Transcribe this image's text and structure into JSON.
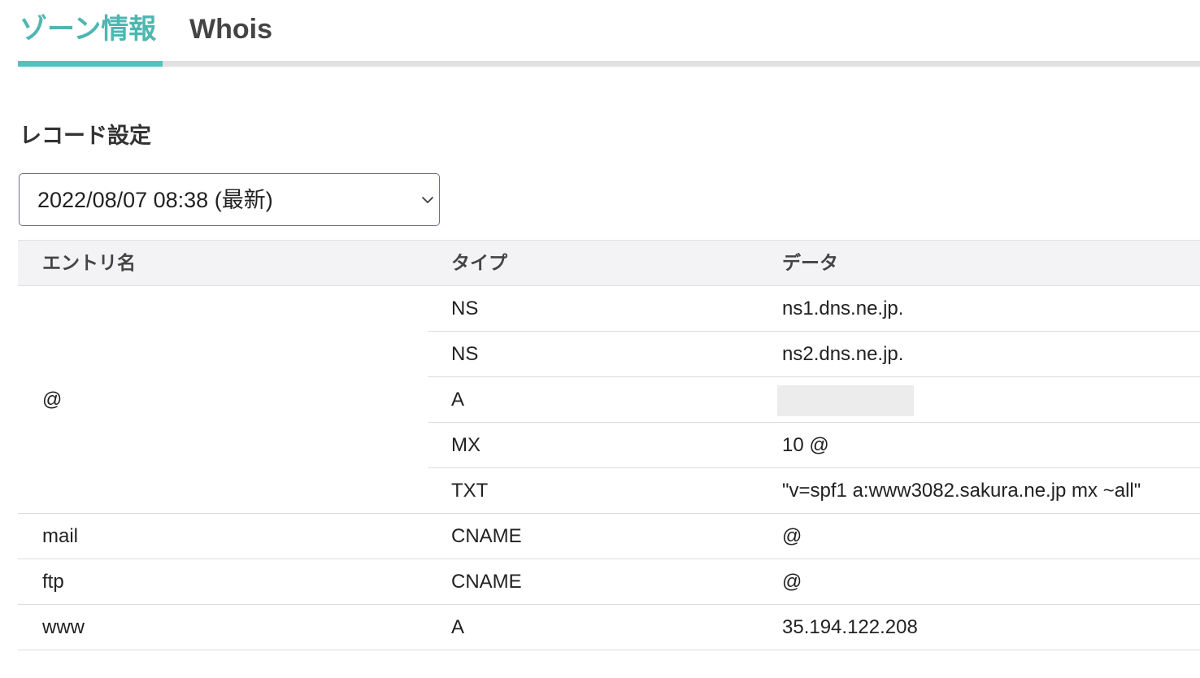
{
  "tabs": [
    {
      "label": "ゾーン情報",
      "active": true
    },
    {
      "label": "Whois",
      "active": false
    }
  ],
  "colors": {
    "accent": "#4fc3bd",
    "active_tab_text": "#4fb6b1",
    "header_bg": "#f3f3f5",
    "redacted_bg": "#ececec"
  },
  "section": {
    "title": "レコード設定"
  },
  "version_select": {
    "selected": "2022/08/07 08:38 (最新)",
    "icon": "chevron-down-icon"
  },
  "table": {
    "headers": [
      "エントリ名",
      "タイプ",
      "データ"
    ],
    "groups": [
      {
        "entry": "@",
        "records": [
          {
            "type": "NS",
            "data": "ns1.dns.ne.jp."
          },
          {
            "type": "NS",
            "data": "ns2.dns.ne.jp."
          },
          {
            "type": "A",
            "data": "",
            "redacted": true
          },
          {
            "type": "MX",
            "data": "10 @"
          },
          {
            "type": "TXT",
            "data": "\"v=spf1 a:www3082.sakura.ne.jp mx ~all\""
          }
        ]
      },
      {
        "entry": "mail",
        "records": [
          {
            "type": "CNAME",
            "data": "@"
          }
        ]
      },
      {
        "entry": "ftp",
        "records": [
          {
            "type": "CNAME",
            "data": "@"
          }
        ]
      },
      {
        "entry": "www",
        "records": [
          {
            "type": "A",
            "data": "35.194.122.208"
          }
        ]
      }
    ]
  }
}
